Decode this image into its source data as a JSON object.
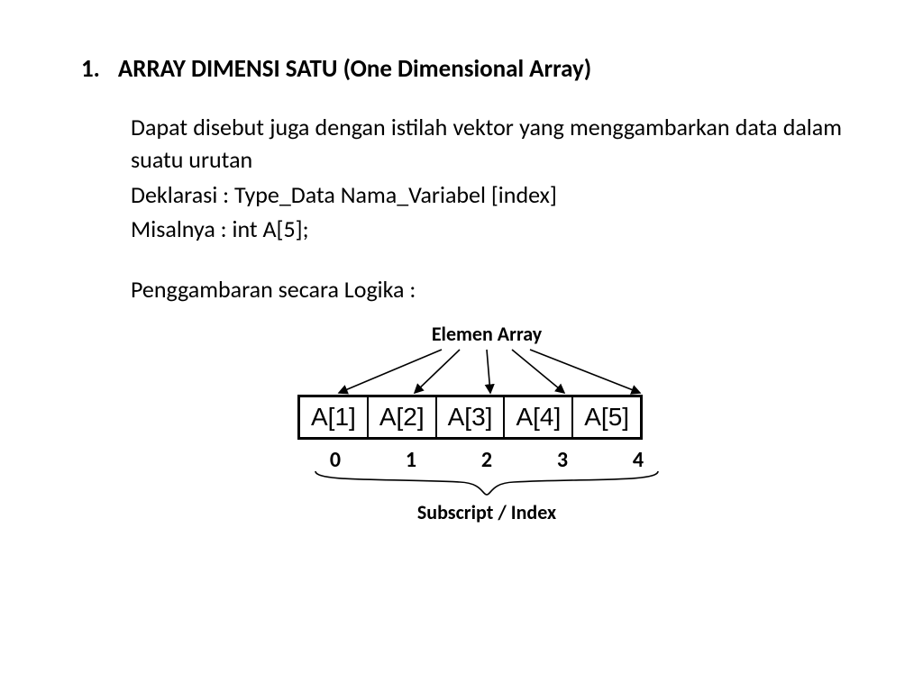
{
  "list_number": "1.",
  "heading": "ARRAY DIMENSI SATU (One Dimensional Array)",
  "paragraph1": "Dapat disebut juga dengan istilah vektor yang menggambarkan data dalam suatu urutan",
  "decl_line": "Deklarasi :  Type_Data Nama_Variabel [index]",
  "example_line": "Misalnya :   int A[5];",
  "subheading": "Penggambaran secara Logika :",
  "diagram": {
    "top_label": "Elemen Array",
    "cells": [
      "A[1]",
      "A[2]",
      "A[3]",
      "A[4]",
      "A[5]"
    ],
    "indices": [
      "0",
      "1",
      "2",
      "3",
      "4"
    ],
    "bottom_label": "Subscript / Index"
  }
}
